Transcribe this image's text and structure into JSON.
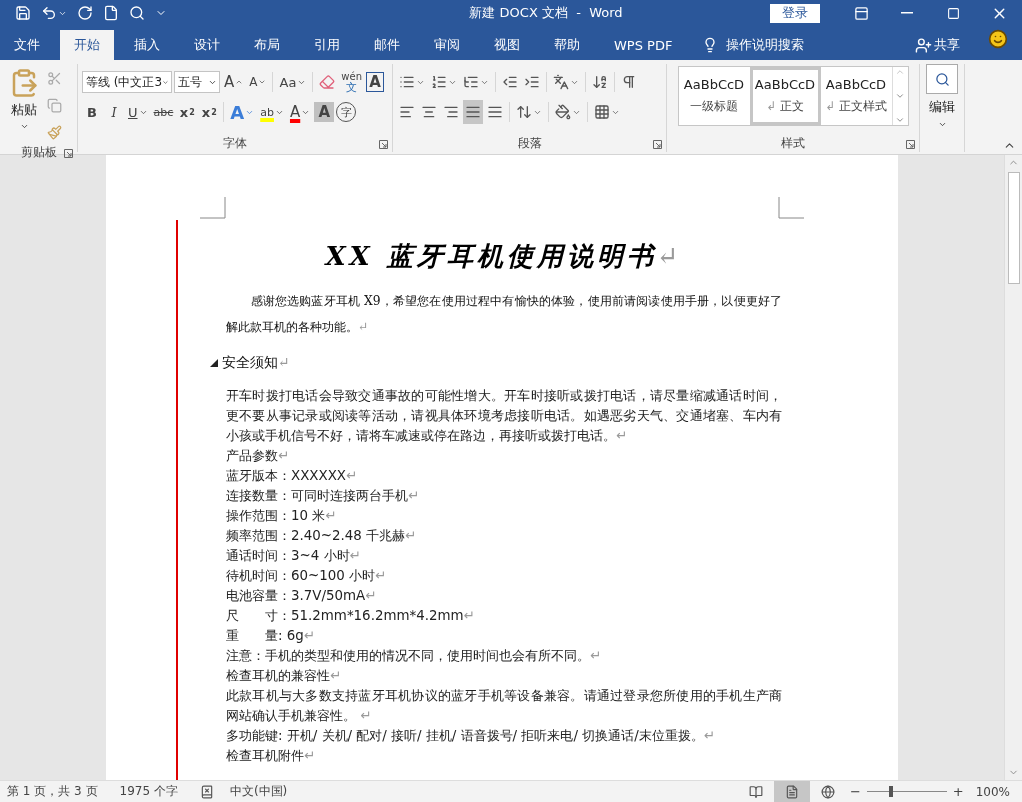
{
  "title_bar": {
    "quick_access": [
      {
        "kind": "save"
      },
      {
        "kind": "undo"
      },
      {
        "kind": "redo"
      },
      {
        "kind": "new"
      },
      {
        "kind": "search"
      },
      {
        "kind": "customize"
      }
    ],
    "title": "新建 DOCX 文档  -  Word",
    "sign_in": "登录"
  },
  "tabs": [
    {
      "label": "文件",
      "selected": false
    },
    {
      "label": "开始",
      "selected": true
    },
    {
      "label": "插入",
      "selected": false
    },
    {
      "label": "设计",
      "selected": false
    },
    {
      "label": "布局",
      "selected": false
    },
    {
      "label": "引用",
      "selected": false
    },
    {
      "label": "邮件",
      "selected": false
    },
    {
      "label": "审阅",
      "selected": false
    },
    {
      "label": "视图",
      "selected": false
    },
    {
      "label": "帮助",
      "selected": false
    },
    {
      "label": "WPS PDF",
      "selected": false
    }
  ],
  "tell_me": "操作说明搜索",
  "share": "共享",
  "ribbon": {
    "clipboard": {
      "paste": "粘贴",
      "label": "剪贴板"
    },
    "font": {
      "font_name": "等线 (中文正3",
      "font_size": "五号",
      "label": "字体",
      "row1": [
        {
          "kind": "grow",
          "label": "A"
        },
        {
          "kind": "shrink",
          "label": "A"
        },
        {
          "kind": "case",
          "label": "Aa"
        },
        {
          "kind": "clear"
        },
        {
          "kind": "phonetic",
          "label": "wén",
          "sub": "文"
        },
        {
          "kind": "border",
          "label": "A"
        }
      ],
      "row2": [
        {
          "kind": "bold",
          "label": "B"
        },
        {
          "kind": "italic",
          "label": "I"
        },
        {
          "kind": "underline",
          "label": "U"
        },
        {
          "kind": "strike",
          "label": "abc"
        },
        {
          "kind": "subscript",
          "label": "x",
          "sub": "2"
        },
        {
          "kind": "superscript",
          "label": "x",
          "sub": "2"
        },
        {
          "kind": "effect",
          "label": "A"
        },
        {
          "kind": "highlight",
          "label": "ab"
        },
        {
          "kind": "color",
          "label": "A"
        },
        {
          "kind": "shading",
          "label": "A"
        },
        {
          "kind": "enclose",
          "label": "字"
        }
      ]
    },
    "paragraph": {
      "label": "段落",
      "row1": [
        {
          "kind": "bullets"
        },
        {
          "kind": "numbering"
        },
        {
          "kind": "multilevel"
        },
        {
          "kind": "outdent"
        },
        {
          "kind": "indent"
        },
        {
          "kind": "asian"
        },
        {
          "kind": "sort"
        },
        {
          "kind": "marks"
        }
      ],
      "alignment": [
        {
          "kind": "left",
          "selected": false
        },
        {
          "kind": "center",
          "selected": false
        },
        {
          "kind": "right",
          "selected": false
        },
        {
          "kind": "justify",
          "selected": true
        },
        {
          "kind": "distributed",
          "selected": false
        }
      ],
      "row2": [
        {
          "kind": "spacing"
        },
        {
          "kind": "shade"
        },
        {
          "kind": "borders"
        }
      ]
    },
    "styles": {
      "label": "样式",
      "items": [
        {
          "preview": "AaBbCcD",
          "name": "一级标题",
          "selected": false
        },
        {
          "preview": "AaBbCcD",
          "mark": "↲",
          "name": "正文",
          "selected": true
        },
        {
          "preview": "AaBbCcD",
          "mark": "↲",
          "name": "正文样式",
          "selected": false
        }
      ]
    },
    "editing": {
      "label": "编辑"
    }
  },
  "document": {
    "title": "XX 蓝牙耳机使用说明书",
    "title_mark": "↵",
    "intro": {
      "text": "感谢您选购蓝牙耳机 X9，希望您在使用过程中有愉快的体验，使用前请阅读使用手册，以便更好了解此款耳机的各种功能。",
      "mark": "↵"
    },
    "heading": {
      "text": "安全须知",
      "mark": "↵"
    },
    "body": [
      {
        "text": "开车时拨打电话会导致交通事故的可能性增大。开车时接听或拨打电话，请尽量缩减通话时间，更不要从事记录或阅读等活动，请视具体环境考虑接听电话。如遇恶劣天气、交通堵塞、车内有小孩或手机信号不好，请将车减速或停在路边，再接听或拨打电话。",
        "mark": "↵"
      },
      {
        "text": "产品参数",
        "mark": "↵"
      },
      {
        "text": "蓝牙版本：XXXXXX",
        "mark": "↵"
      },
      {
        "text": "连接数量：可同时连接两台手机",
        "mark": "↵"
      },
      {
        "text": "操作范围：10 米",
        "mark": "↵"
      },
      {
        "text": "频率范围：2.40~2.48 千兆赫",
        "mark": "↵"
      },
      {
        "text": "通话时间：3~4 小时",
        "mark": "↵"
      },
      {
        "text": "待机时间：60~100 小时",
        "mark": "↵"
      },
      {
        "text": "电池容量：3.7V/50mA",
        "mark": "↵"
      },
      {
        "text": "尺　　寸：51.2mm*16.2mm*4.2mm",
        "mark": "↵"
      },
      {
        "text": "重　　量: 6g",
        "mark": "↵"
      },
      {
        "text": "注意：手机的类型和使用的情况不同，使用时间也会有所不同。",
        "mark": "↵"
      },
      {
        "text": "检查耳机的兼容性",
        "mark": "↵"
      },
      {
        "text": "此款耳机与大多数支持蓝牙耳机协议的蓝牙手机等设备兼容。请通过登录您所使用的手机生产商网站确认手机兼容性。 ",
        "mark": "↵"
      },
      {
        "text": "多功能键: 开机/ 关机/ 配对/ 接听/ 挂机/ 语音拨号/ 拒听来电/ 切换通话/末位重拨。",
        "mark": "↵"
      },
      {
        "text": "检查耳机附件",
        "mark": "↵"
      }
    ]
  },
  "status_bar": {
    "page": "第 1 页，共 3 页",
    "words": "1975 个字",
    "language": "中文(中国)",
    "views": [
      {
        "kind": "read",
        "selected": false
      },
      {
        "kind": "print",
        "selected": true
      },
      {
        "kind": "web",
        "selected": false
      }
    ],
    "zoom": {
      "minus": "−",
      "plus": "+",
      "level": 0.3,
      "reading": "100%"
    }
  }
}
